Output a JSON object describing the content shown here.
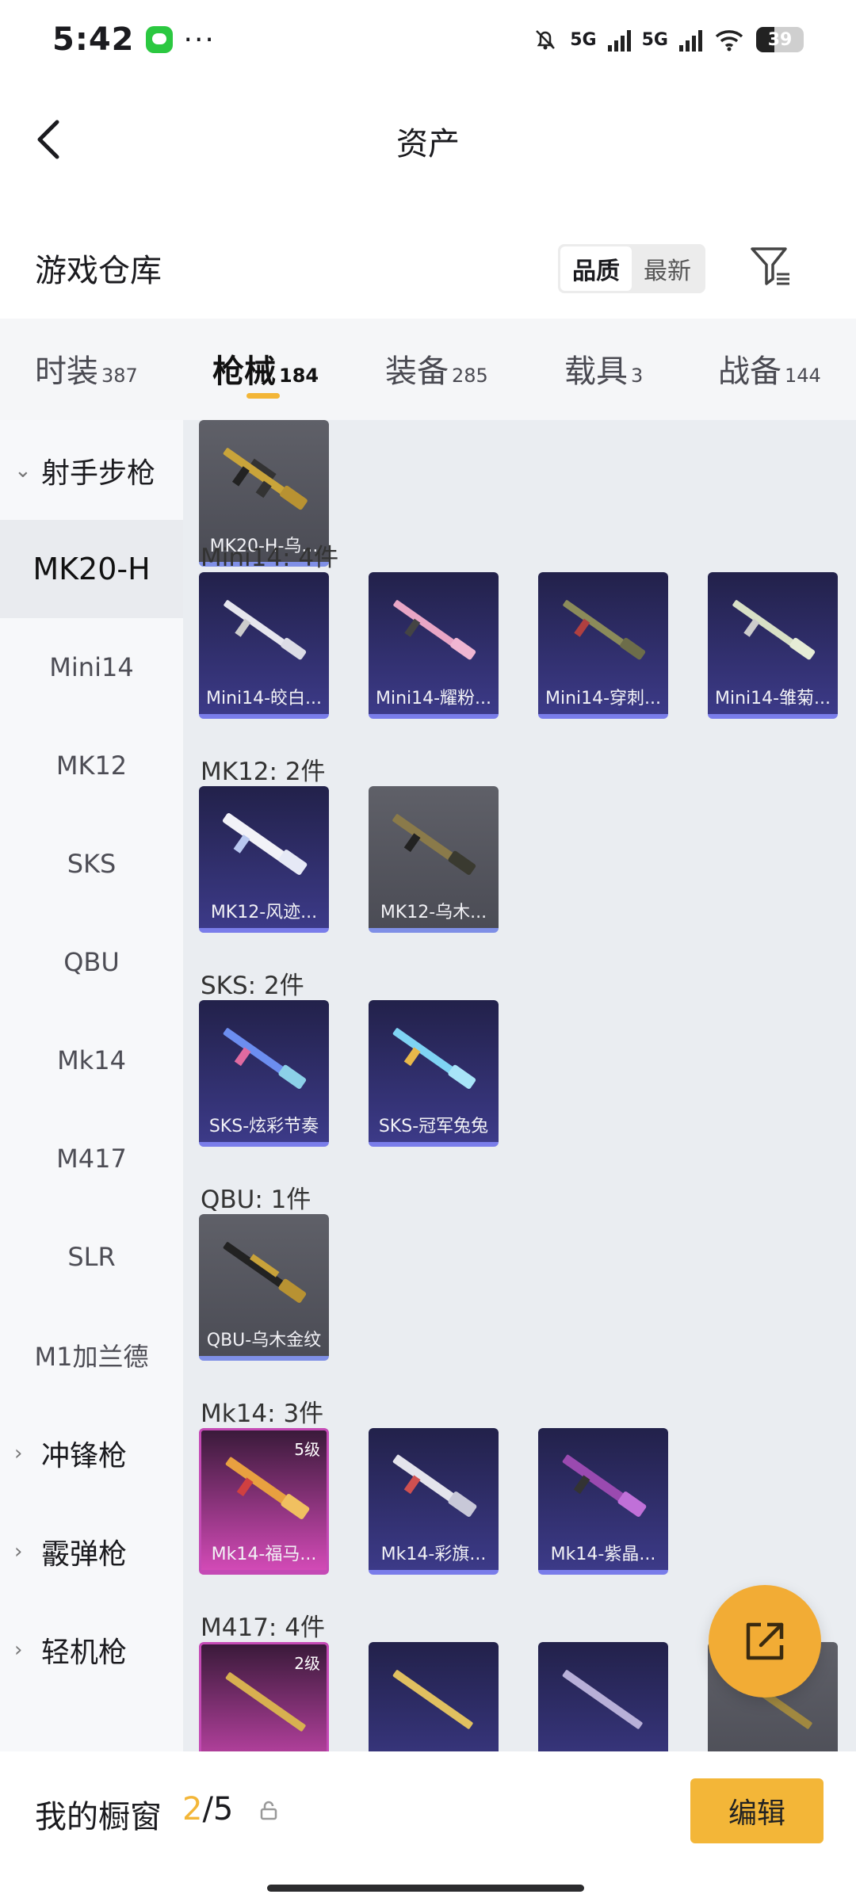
{
  "status": {
    "time": "5:42",
    "dots": "···",
    "net1": "5G",
    "net2": "5G",
    "battery": "39"
  },
  "header": {
    "title": "资产"
  },
  "warehouse": {
    "title": "游戏仓库",
    "sort_quality": "品质",
    "sort_latest": "最新"
  },
  "tabs": [
    {
      "label": "时装",
      "count": "387"
    },
    {
      "label": "枪械",
      "count": "184"
    },
    {
      "label": "装备",
      "count": "285"
    },
    {
      "label": "载具",
      "count": "3"
    },
    {
      "label": "战备",
      "count": "144"
    }
  ],
  "sidebar": {
    "group_dmr": "射手步枪",
    "items": [
      "MK20-H",
      "Mini14",
      "MK12",
      "SKS",
      "QBU",
      "Mk14",
      "M417",
      "SLR",
      "M1加兰德"
    ],
    "group_smg": "冲锋枪",
    "group_shotgun": "霰弹枪",
    "group_lmg": "轻机枪"
  },
  "sections": {
    "mk20": {
      "cards": [
        "MK20-H-乌..."
      ]
    },
    "mini14": {
      "title": "Mini14: 4件",
      "cards": [
        "Mini14-皎白...",
        "Mini14-耀粉...",
        "Mini14-穿刺...",
        "Mini14-雏菊..."
      ]
    },
    "mk12": {
      "title": "MK12: 2件",
      "cards": [
        "MK12-风迹...",
        "MK12-乌木..."
      ]
    },
    "sks": {
      "title": "SKS: 2件",
      "cards": [
        "SKS-炫彩节奏",
        "SKS-冠军兔兔"
      ]
    },
    "qbu": {
      "title": "QBU: 1件",
      "cards": [
        "QBU-乌木金纹"
      ]
    },
    "mk14": {
      "title": "Mk14: 3件",
      "cards": [
        "Mk14-福马...",
        "Mk14-彩旗...",
        "Mk14-紫晶..."
      ],
      "level": "5级"
    },
    "m417": {
      "title": "M417: 4件",
      "level": "2级"
    }
  },
  "bottom": {
    "window_label": "我的橱窗",
    "current": "2",
    "total": "/5",
    "edit": "编辑"
  },
  "colors": {
    "accent": "#f3b638",
    "fab": "#f2ac35"
  },
  "icons": [
    "back-arrow-icon",
    "filter-icon",
    "share-icon",
    "lock-icon",
    "chevron-down-icon",
    "chevron-right-icon",
    "rifle-icon"
  ]
}
